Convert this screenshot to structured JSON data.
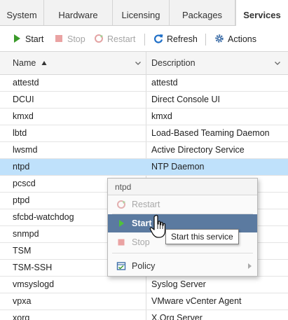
{
  "tabs": [
    {
      "label": "System"
    },
    {
      "label": "Hardware"
    },
    {
      "label": "Licensing"
    },
    {
      "label": "Packages"
    },
    {
      "label": "Services",
      "active": true
    }
  ],
  "toolbar": {
    "start_label": "Start",
    "stop_label": "Stop",
    "restart_label": "Restart",
    "refresh_label": "Refresh",
    "actions_label": "Actions"
  },
  "grid": {
    "columns": [
      {
        "label": "Name",
        "sort": "ascending"
      },
      {
        "label": "Description"
      }
    ],
    "rows": [
      {
        "name": "attestd",
        "description": "attestd"
      },
      {
        "name": "DCUI",
        "description": "Direct Console UI"
      },
      {
        "name": "kmxd",
        "description": "kmxd"
      },
      {
        "name": "lbtd",
        "description": "Load-Based Teaming Daemon"
      },
      {
        "name": "lwsmd",
        "description": "Active Directory Service"
      },
      {
        "name": "ntpd",
        "description": "NTP Daemon",
        "selected": true
      },
      {
        "name": "pcscd",
        "description": ""
      },
      {
        "name": "ptpd",
        "description": ""
      },
      {
        "name": "sfcbd-watchdog",
        "description": ""
      },
      {
        "name": "snmpd",
        "description": ""
      },
      {
        "name": "TSM",
        "description": ""
      },
      {
        "name": "TSM-SSH",
        "description": ""
      },
      {
        "name": "vmsyslogd",
        "description": "Syslog Server"
      },
      {
        "name": "vpxa",
        "description": "VMware vCenter Agent"
      },
      {
        "name": "xorg",
        "description": "X.Org Server"
      }
    ]
  },
  "context_menu": {
    "title": "ntpd",
    "items": [
      {
        "label": "Restart",
        "enabled": false
      },
      {
        "label": "Start",
        "enabled": true,
        "highlighted": true
      },
      {
        "label": "Stop",
        "enabled": false
      },
      {
        "label": "Policy",
        "enabled": true,
        "has_submenu": true
      }
    ]
  },
  "tooltip": {
    "text": "Start this service"
  },
  "colors": {
    "selected_row": "#bfe1fb",
    "menu_highlight": "#5b7aa0",
    "start_green": "#3a9a2a",
    "refresh_blue": "#1f6fc7",
    "stop_red": "#e06a6a"
  },
  "icons": {
    "start": "play-icon",
    "stop": "stop-icon",
    "restart": "restart-icon",
    "refresh": "refresh-icon",
    "actions": "gear-icon",
    "policy": "policy-icon",
    "sort": "sort-ascending-icon",
    "column_menu": "chevron-down-icon"
  }
}
